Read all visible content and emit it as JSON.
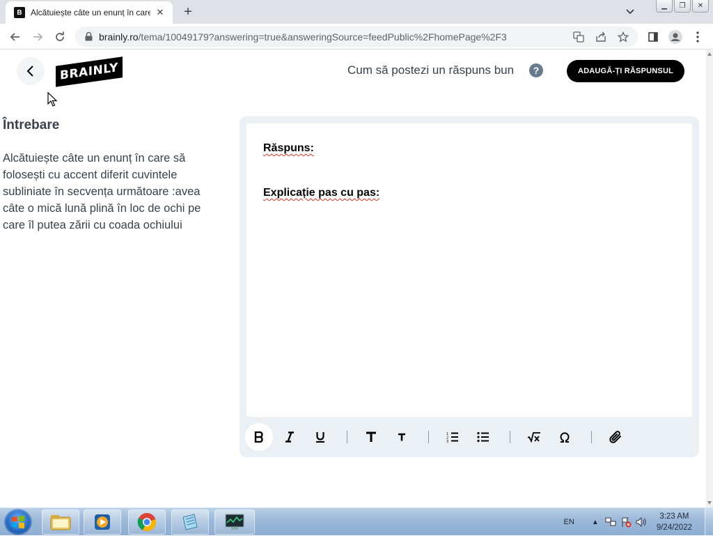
{
  "browser": {
    "tab_title": "Alcătuiește câte un enunț în care",
    "url_host": "brainly.ro",
    "url_path": "/tema/10049179?answering=true&answeringSource=feedPublic%2FhomePage%2F3"
  },
  "header": {
    "logo_text": "BRAINLY",
    "how_to_link": "Cum să postezi un răspuns bun",
    "help_label": "?",
    "add_answer_button": "ADAUGĂ-ȚI RĂSPUNSUL"
  },
  "question": {
    "heading": "Întrebare",
    "text": "Alcătuiește câte un enunț în care să folosești cu accent diferit cuvintele subliniate în secvența următoare :avea câte o mică lună plină în loc de ochi pe care îl putea zării cu coada ochiului"
  },
  "editor": {
    "line1": "Răspuns:",
    "line2": "Explicație pas cu pas:"
  },
  "toolbar_icons": [
    "bold-icon",
    "italic-icon",
    "underline-icon",
    "heading-large-icon",
    "heading-small-icon",
    "ordered-list-icon",
    "bullet-list-icon",
    "math-formula-icon",
    "special-symbol-icon",
    "attachment-icon"
  ],
  "taskbar": {
    "language": "EN",
    "time": "3:23 AM",
    "date": "9/24/2022"
  }
}
